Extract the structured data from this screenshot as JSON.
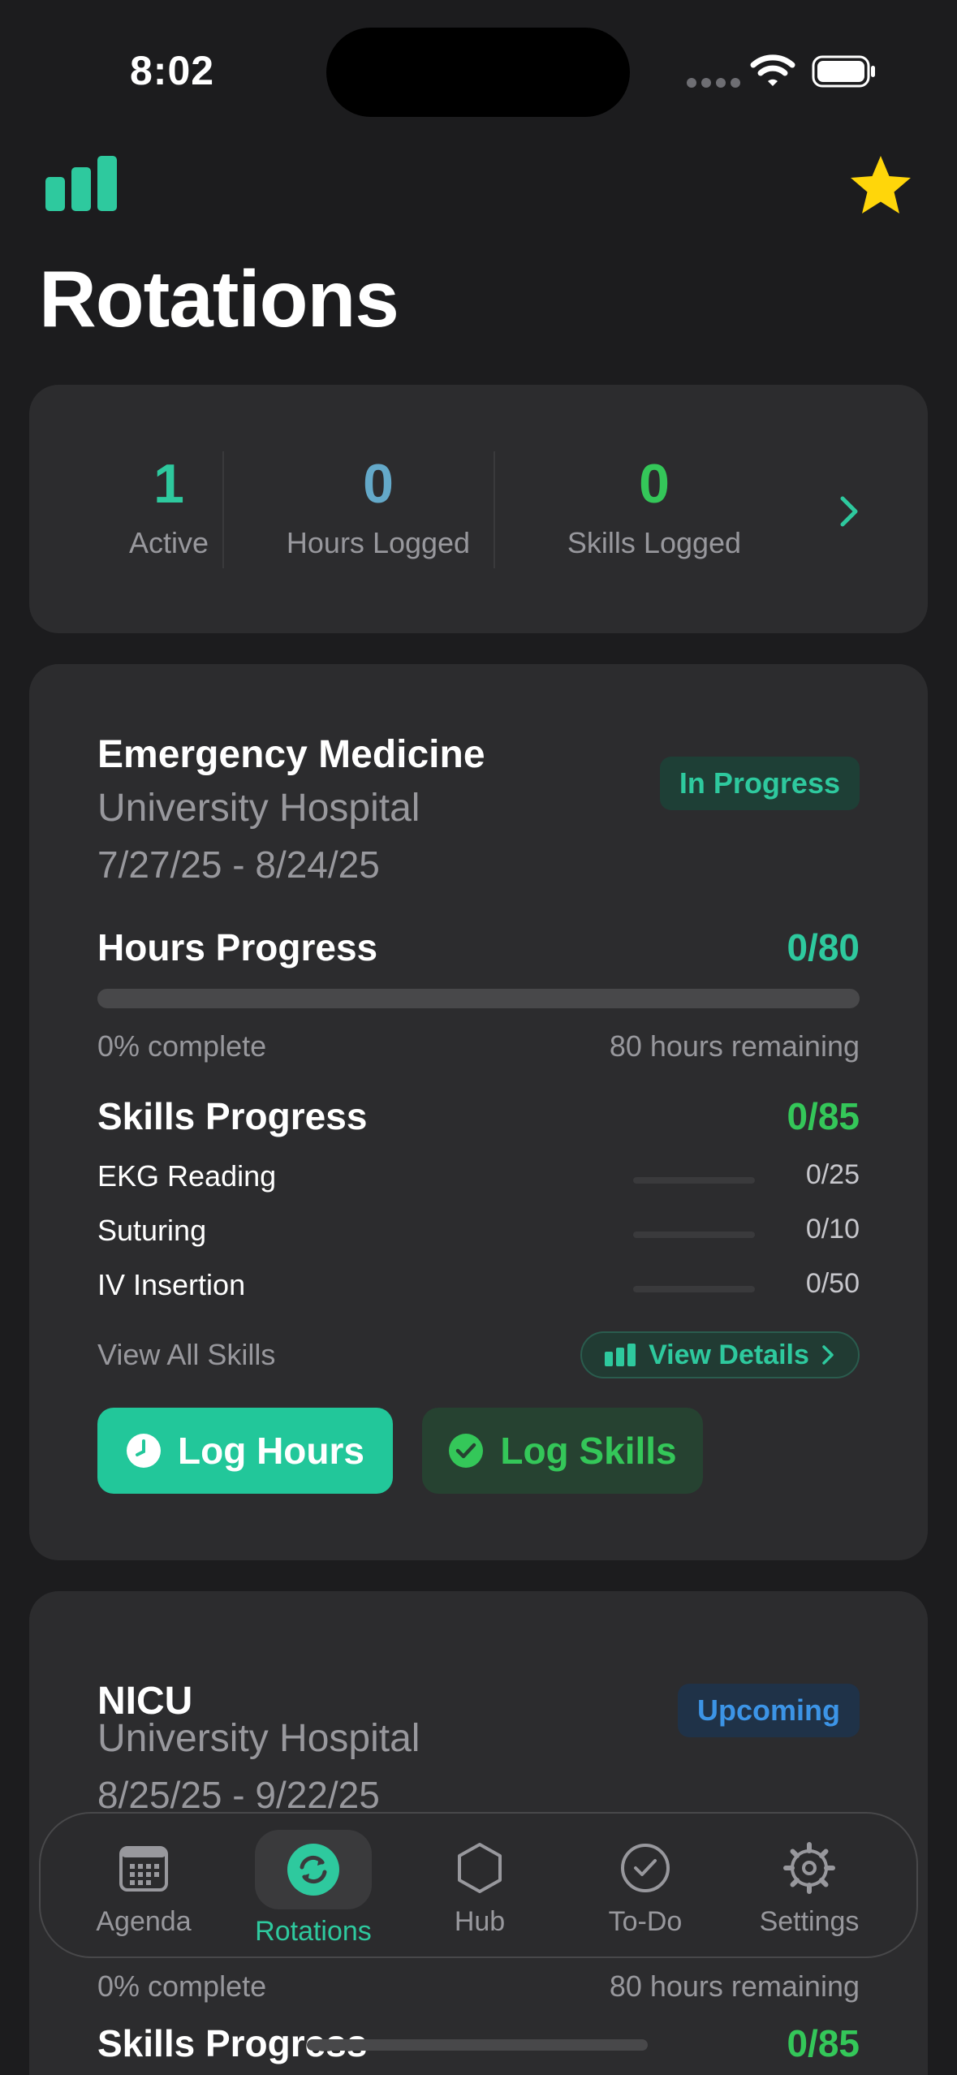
{
  "status_bar": {
    "time": "8:02"
  },
  "header": {
    "title": "Rotations",
    "logo_icon": "bar-chart-icon",
    "favorite_icon": "star-icon"
  },
  "colors": {
    "accent": "#2ec99e",
    "green": "#34c759",
    "blue": "#3c94e6",
    "star": "#ffd60a"
  },
  "stats": {
    "active": {
      "value": "1",
      "label": "Active"
    },
    "hours": {
      "value": "0",
      "label": "Hours Logged"
    },
    "skills": {
      "value": "0",
      "label": "Skills Logged"
    }
  },
  "rotations": [
    {
      "title": "Emergency Medicine",
      "place": "University Hospital",
      "dates": "7/27/25 - 8/24/25",
      "status": "In Progress",
      "hours_title": "Hours Progress",
      "hours_count": "0/80",
      "hours_progress": 0,
      "percent_text": "0% complete",
      "remaining_text": "80 hours remaining",
      "skills_title": "Skills Progress",
      "skills_count": "0/85",
      "skills": [
        {
          "name": "EKG Reading",
          "count": "0/25",
          "progress": 0
        },
        {
          "name": "Suturing",
          "count": "0/10",
          "progress": 0
        },
        {
          "name": "IV Insertion",
          "count": "0/50",
          "progress": 0
        }
      ],
      "view_all_label": "View All Skills",
      "view_details_label": "View Details",
      "log_hours_label": "Log Hours",
      "log_skills_label": "Log Skills"
    },
    {
      "title": "NICU",
      "place": "University Hospital",
      "dates": "8/25/25 - 9/22/25",
      "status": "Upcoming",
      "percent_text": "0% complete",
      "remaining_text": "80 hours remaining",
      "skills_title": "Skills Progress",
      "skills_count": "0/85"
    }
  ],
  "tabs": [
    {
      "label": "Agenda",
      "icon": "calendar-icon"
    },
    {
      "label": "Rotations",
      "icon": "sync-icon",
      "active": true
    },
    {
      "label": "Hub",
      "icon": "hexagon-icon"
    },
    {
      "label": "To-Do",
      "icon": "checkmark-circle-icon"
    },
    {
      "label": "Settings",
      "icon": "gear-icon"
    }
  ]
}
